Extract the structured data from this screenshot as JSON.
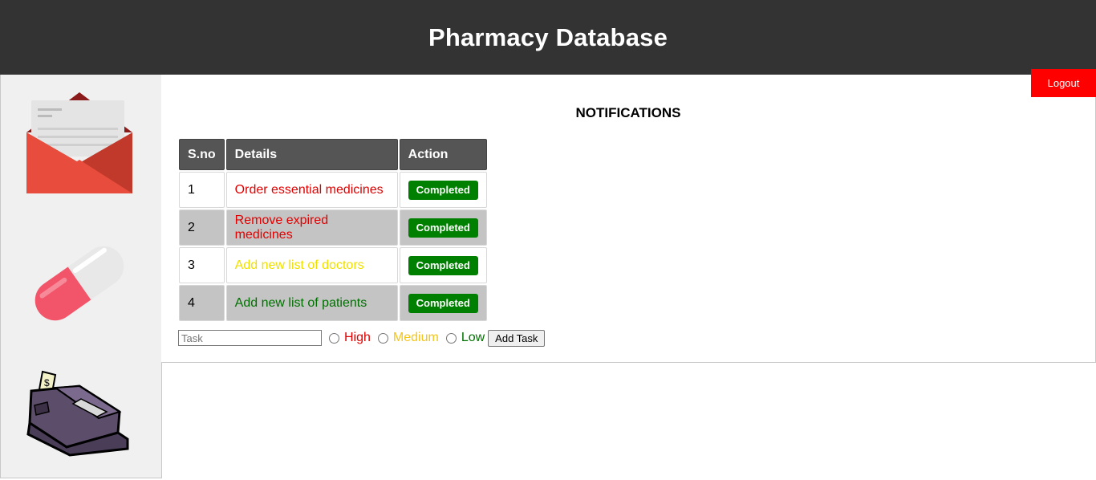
{
  "header": {
    "title": "Pharmacy Database"
  },
  "logout_label": "Logout",
  "notifications": {
    "title": "NOTIFICATIONS",
    "columns": [
      "S.no",
      "Details",
      "Action"
    ],
    "rows": [
      {
        "sno": "1",
        "details": "Order essential medicines",
        "color": "#e00000",
        "action": "Completed"
      },
      {
        "sno": "2",
        "details": "Remove expired medicines",
        "color": "#e00000",
        "action": "Completed"
      },
      {
        "sno": "3",
        "details": "Add new list of doctors",
        "color": "#f0e000",
        "action": "Completed"
      },
      {
        "sno": "4",
        "details": "Add new list of patients",
        "color": "#007000",
        "action": "Completed"
      }
    ]
  },
  "task_form": {
    "placeholder": "Task",
    "priorities": [
      {
        "label": "High",
        "color": "#e00000"
      },
      {
        "label": "Medium",
        "color": "#f5c518"
      },
      {
        "label": "Low",
        "color": "#007000"
      }
    ],
    "add_label": "Add Task"
  },
  "sidebar": {
    "icons": [
      "envelope-icon",
      "capsule-icon",
      "cash-register-icon"
    ]
  }
}
